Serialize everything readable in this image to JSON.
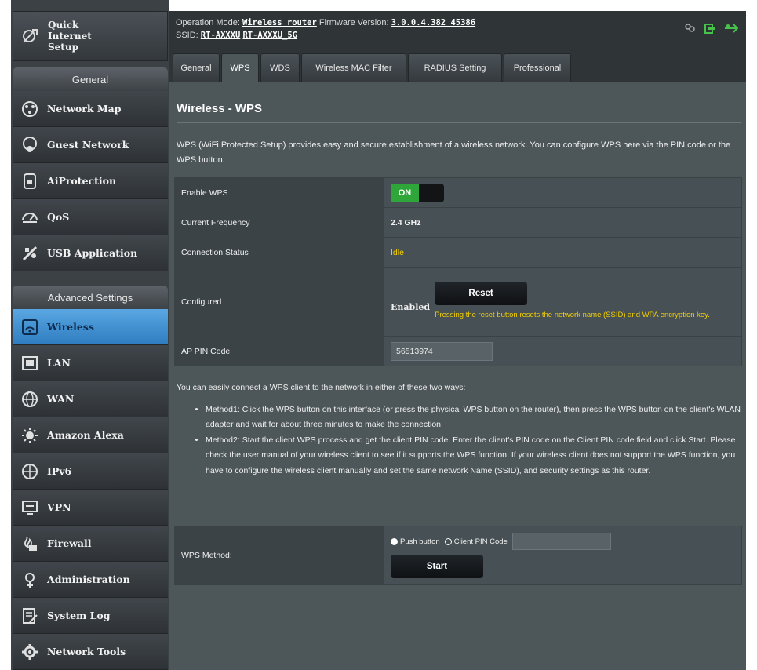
{
  "topbar": {
    "op_mode_label": "Operation Mode:",
    "op_mode_value": "Wireless router",
    "fw_label": "Firmware Version:",
    "fw_value": "3.0.0.4.382_45386",
    "ssid_label": "SSID:",
    "ssid_1": "RT-AXXXU",
    "ssid_2": "RT-AXXXU_5G",
    "status_icons": [
      "users-icon",
      "usb-icon",
      "network-icon"
    ]
  },
  "sidebar": {
    "quick_setup": "Quick Internet Setup",
    "general_header": "General",
    "general_items": [
      {
        "label": "Network Map",
        "icon": "network-map-icon"
      },
      {
        "label": "Guest Network",
        "icon": "guest-network-icon"
      },
      {
        "label": "AiProtection",
        "icon": "lock-icon"
      },
      {
        "label": "QoS",
        "icon": "gauge-icon"
      },
      {
        "label": "USB Application",
        "icon": "usb-app-icon"
      }
    ],
    "advanced_header": "Advanced Settings",
    "advanced_items": [
      {
        "label": "Wireless",
        "icon": "wifi-icon",
        "active": true
      },
      {
        "label": "LAN",
        "icon": "lan-icon"
      },
      {
        "label": "WAN",
        "icon": "globe-icon"
      },
      {
        "label": "Amazon Alexa",
        "icon": "alexa-icon"
      },
      {
        "label": "IPv6",
        "icon": "ipv6-globe-icon"
      },
      {
        "label": "VPN",
        "icon": "vpn-icon"
      },
      {
        "label": "Firewall",
        "icon": "firewall-icon"
      },
      {
        "label": "Administration",
        "icon": "admin-icon"
      },
      {
        "label": "System Log",
        "icon": "system-log-icon"
      },
      {
        "label": "Network Tools",
        "icon": "tools-icon"
      }
    ]
  },
  "tabs": [
    {
      "label": "General"
    },
    {
      "label": "WPS",
      "active": true
    },
    {
      "label": "WDS"
    },
    {
      "label": "Wireless MAC Filter"
    },
    {
      "label": "RADIUS Setting"
    },
    {
      "label": "Professional"
    }
  ],
  "main": {
    "title": "Wireless - WPS",
    "intro": "WPS (WiFi Protected Setup) provides easy and secure establishment of a wireless network. You can configure WPS here via the PIN code or the WPS button.",
    "rows": {
      "enable_label": "Enable WPS",
      "enable_value": "ON",
      "freq_label": "Current Frequency",
      "freq_value": "2.4 GHz",
      "conn_label": "Connection Status",
      "conn_value": "Idle",
      "configured_label": "Configured",
      "reset_button": "Reset",
      "configured_value": "Enabled",
      "reset_note": "Pressing the reset button resets the network name (SSID) and WPA encryption key.",
      "ap_pin_label": "AP PIN Code",
      "ap_pin_value": "56513974"
    },
    "methods_intro": "You can easily connect a WPS client to the network in either of these two ways:",
    "method1": "Method1: Click the WPS button on this interface (or press the physical WPS button on the router), then press the WPS button on the client's WLAN adapter and wait for about three minutes to make the connection.",
    "method2": "Method2: Start the client WPS process and get the client PIN code. Enter the client's PIN code on the Client PIN code field and click Start. Please check the user manual of your wireless client to see if it supports the WPS function. If your wireless client does not support the WPS function, you have to configure the wireless client manually and set the same network Name (SSID), and security settings as this router.",
    "wps_method_label": "WPS Method:",
    "push_button_label": "Push button",
    "client_pin_label": "Client PIN Code",
    "client_pin_value": "",
    "start_button": "Start"
  },
  "colors": {
    "accent_blue": "#3f8fd2",
    "toggle_green": "#2ea63a",
    "status_yellow": "#f3d000"
  }
}
